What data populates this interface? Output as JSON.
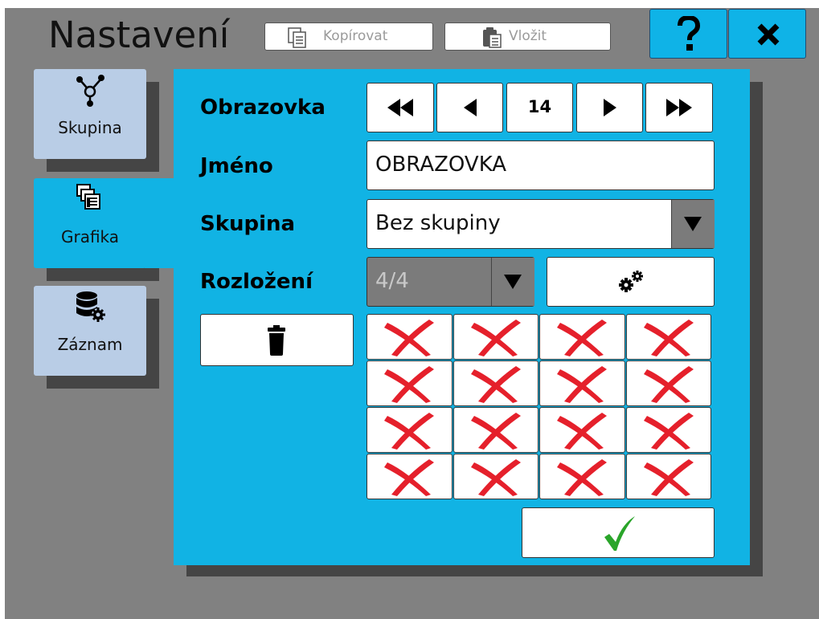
{
  "header": {
    "title": "Nastavení",
    "copy_label": "Kopírovat",
    "paste_label": "Vložit",
    "help_label": "?",
    "close_label": "✕"
  },
  "sidebar": {
    "items": [
      {
        "label": "Skupina",
        "icon": "network-icon",
        "active": false
      },
      {
        "label": "Grafika",
        "icon": "screens-icon",
        "active": true
      },
      {
        "label": "Záznam",
        "icon": "database-gear-icon",
        "active": false
      }
    ]
  },
  "form": {
    "screen_label": "Obrazovka",
    "screen_number": "14",
    "name_label": "Jméno",
    "name_value": "OBRAZOVKA",
    "group_label": "Skupina",
    "group_value": "Bez skupiny",
    "layout_label": "Rozložení",
    "layout_value": "4/4"
  },
  "grid": {
    "rows": 4,
    "cols": 4,
    "cell_state": "empty",
    "cell_icon": "red-x-icon"
  },
  "colors": {
    "accent": "#11b3e4",
    "background": "#818181",
    "sidebar_inactive": "#b9cde6",
    "cross": "#e5202b",
    "check": "#2aa52a"
  }
}
